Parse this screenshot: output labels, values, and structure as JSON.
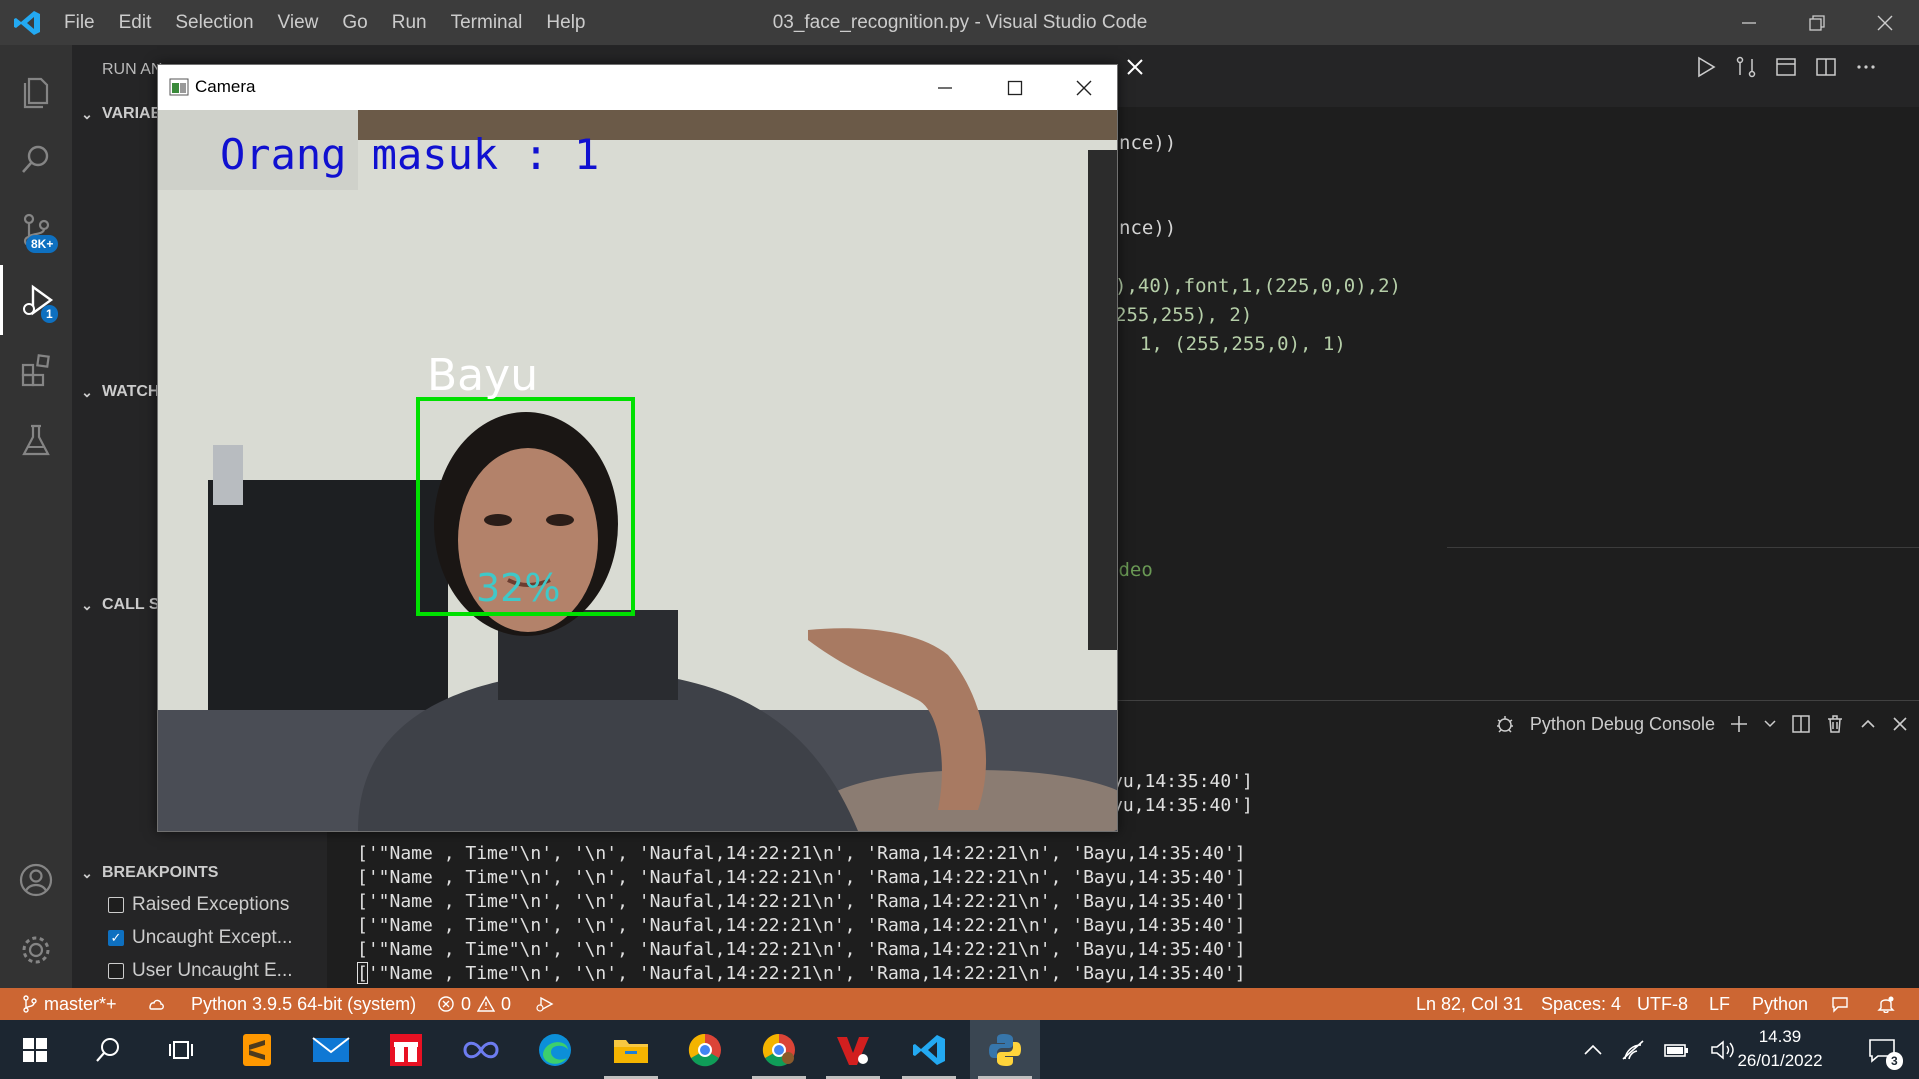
{
  "window": {
    "title": "03_face_recognition.py - Visual Studio Code",
    "menu": [
      "File",
      "Edit",
      "Selection",
      "View",
      "Go",
      "Run",
      "Terminal",
      "Help"
    ]
  },
  "activity": {
    "source_control_badge": "8K+",
    "debug_badge": "1"
  },
  "sidebar": {
    "header": "RUN AN",
    "sections": {
      "variables": "VARIAE",
      "watch": "WATCH",
      "call_stack": "CALL ST",
      "breakpoints": "BREAKPOINTS"
    },
    "breakpoints": [
      {
        "label": "Raised Exceptions",
        "checked": false
      },
      {
        "label": "Uncaught Except...",
        "checked": true
      },
      {
        "label": "User Uncaught E...",
        "checked": false
      }
    ]
  },
  "editor": {
    "lines": [
      "nce))",
      "nce))",
      "),40),font,1,(225,0,0),2)",
      "255,255), 2)",
      "  1, (255,255,0), 1)",
      "ideo"
    ]
  },
  "panel": {
    "console_selector": "Python Debug Console",
    "partial_lines": [
      "yu,14:35:40']",
      "yu,14:35:40']"
    ],
    "output_lines": [
      "['\"Name , Time\"\\n', '\\n', 'Naufal,14:22:21\\n', 'Rama,14:22:21\\n', 'Bayu,14:35:40']",
      "['\"Name , Time\"\\n', '\\n', 'Naufal,14:22:21\\n', 'Rama,14:22:21\\n', 'Bayu,14:35:40']",
      "['\"Name , Time\"\\n', '\\n', 'Naufal,14:22:21\\n', 'Rama,14:22:21\\n', 'Bayu,14:35:40']",
      "['\"Name , Time\"\\n', '\\n', 'Naufal,14:22:21\\n', 'Rama,14:22:21\\n', 'Bayu,14:35:40']",
      "['\"Name , Time\"\\n', '\\n', 'Naufal,14:22:21\\n', 'Rama,14:22:21\\n', 'Bayu,14:35:40']",
      "['\"Name , Time\"\\n', '\\n', 'Naufal,14:22:21\\n', 'Rama,14:22:21\\n', 'Bayu,14:35:40']"
    ]
  },
  "statusbar": {
    "branch": "master*+",
    "interpreter": "Python 3.9.5 64-bit (system)",
    "errors": "0",
    "warnings": "0",
    "position": "Ln 82, Col 31",
    "spaces": "Spaces: 4",
    "encoding": "UTF-8",
    "eol": "LF",
    "language": "Python"
  },
  "camera": {
    "title": "Camera",
    "counter_text": "Orang masuk : 1",
    "face_name": "Bayu",
    "confidence": "32%"
  },
  "taskbar": {
    "time": "14.39",
    "date": "26/01/2022",
    "notification_count": "3"
  },
  "colors": {
    "statusbar": "#cc6633",
    "face_box": "#00e000",
    "counter_text": "#1010d0",
    "confidence_text": "#40c8c8"
  }
}
